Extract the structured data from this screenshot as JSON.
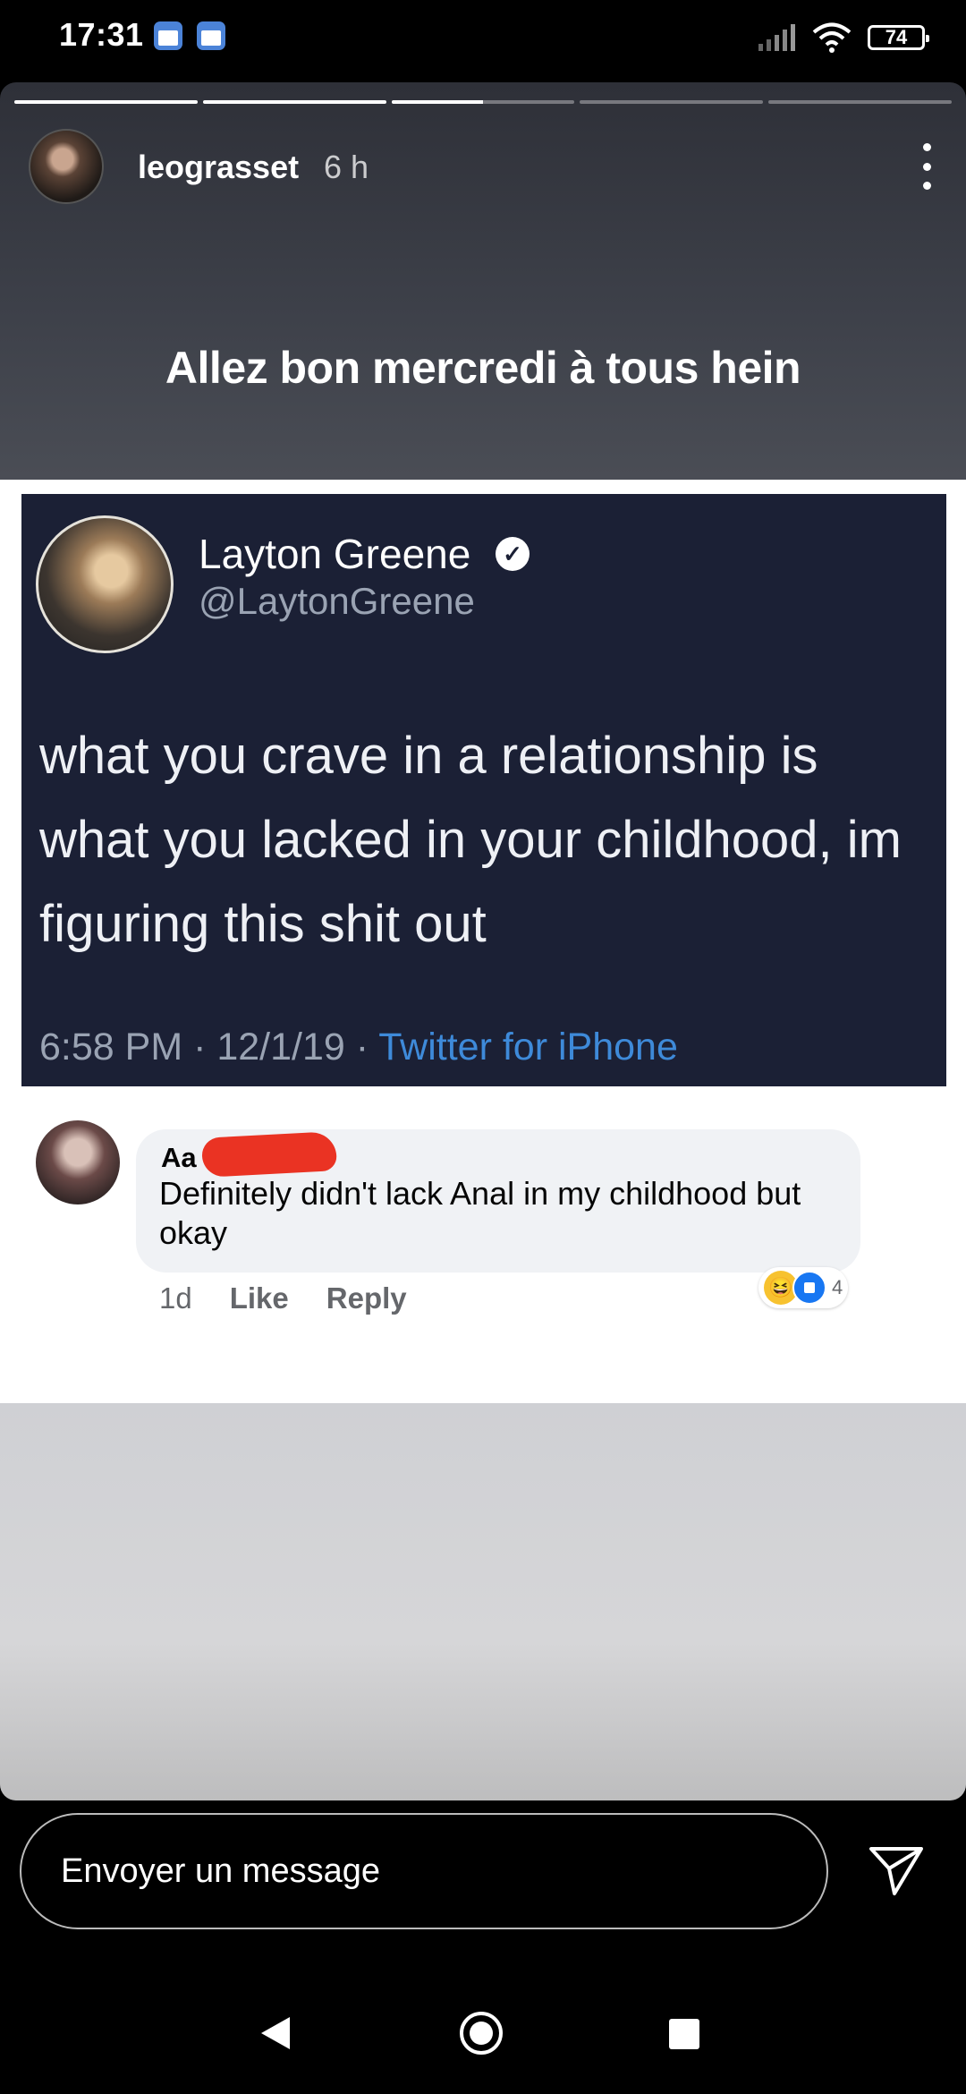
{
  "status_bar": {
    "time": "17:31",
    "battery": "74",
    "icons": [
      "calendar-icon",
      "calendar-icon",
      "signal-icon",
      "wifi-icon",
      "battery-icon"
    ]
  },
  "story": {
    "progress": [
      1,
      1,
      0.5,
      0,
      0
    ],
    "username": "leograsset",
    "time_ago": "6 h",
    "caption": "Allez bon mercredi à tous hein"
  },
  "tweet": {
    "name": "Layton Greene",
    "handle": "@LaytonGreene",
    "text": "what you crave in a relationship is what you lacked in your childhood, im figuring this shit out",
    "date": "6:58 PM · 12/1/19 · ",
    "source": "Twitter for iPhone"
  },
  "comment": {
    "author_initials": "Aa",
    "text": "Definitely didn't lack Anal in my childhood but okay",
    "age": "1d",
    "like_label": "Like",
    "reply_label": "Reply",
    "reaction_count": "4"
  },
  "reply_bar": {
    "placeholder": "Envoyer un message"
  }
}
